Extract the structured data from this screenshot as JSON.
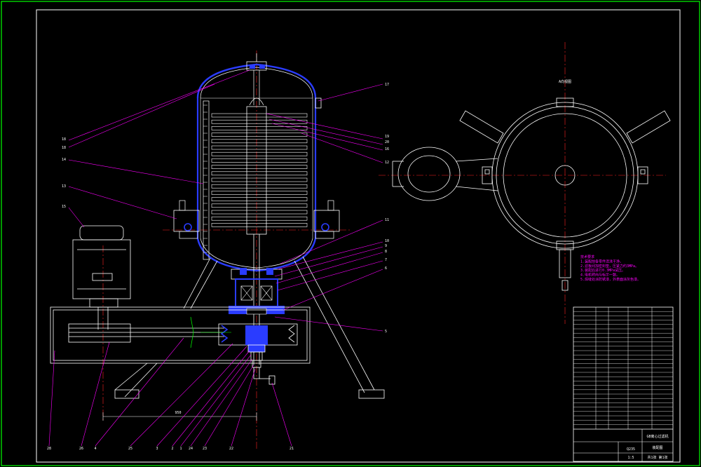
{
  "colors": {
    "background": "#000000",
    "outer_border": "#00ff00",
    "lines": "#ffffff",
    "leaders": "#ff00ff",
    "center_lines": "#ff2020",
    "vessel": "#2a3cff",
    "green_detail": "#00ff00"
  },
  "view_label": "A向视图",
  "dimension_label": "950",
  "part_numbers_left": [
    "18",
    "18",
    "14",
    "13",
    "15"
  ],
  "part_numbers_right": [
    "17",
    "19",
    "20",
    "16",
    "12",
    "11",
    "10",
    "9",
    "8",
    "7",
    "6",
    "5"
  ],
  "part_numbers_bottom": [
    "28",
    "26",
    "4",
    "25",
    "3",
    "2",
    "1",
    "24",
    "23",
    "22",
    "21"
  ],
  "tech_notes": [
    "技术要求",
    "1.装配前各零件清洗干净。",
    "2.滤板间加密封垫，压紧力约3MPa。",
    "3.装配后进行0.3MPa试压。",
    "4.电机转向与标示一致。",
    "5.焊缝处涂防锈漆，外表面涂灰色漆。"
  ],
  "title_block": {
    "title": "GB离心过滤机",
    "drawing_no": "装配图",
    "material": "Q235",
    "scale": "1:5",
    "sheet": "共1张 第1张"
  }
}
